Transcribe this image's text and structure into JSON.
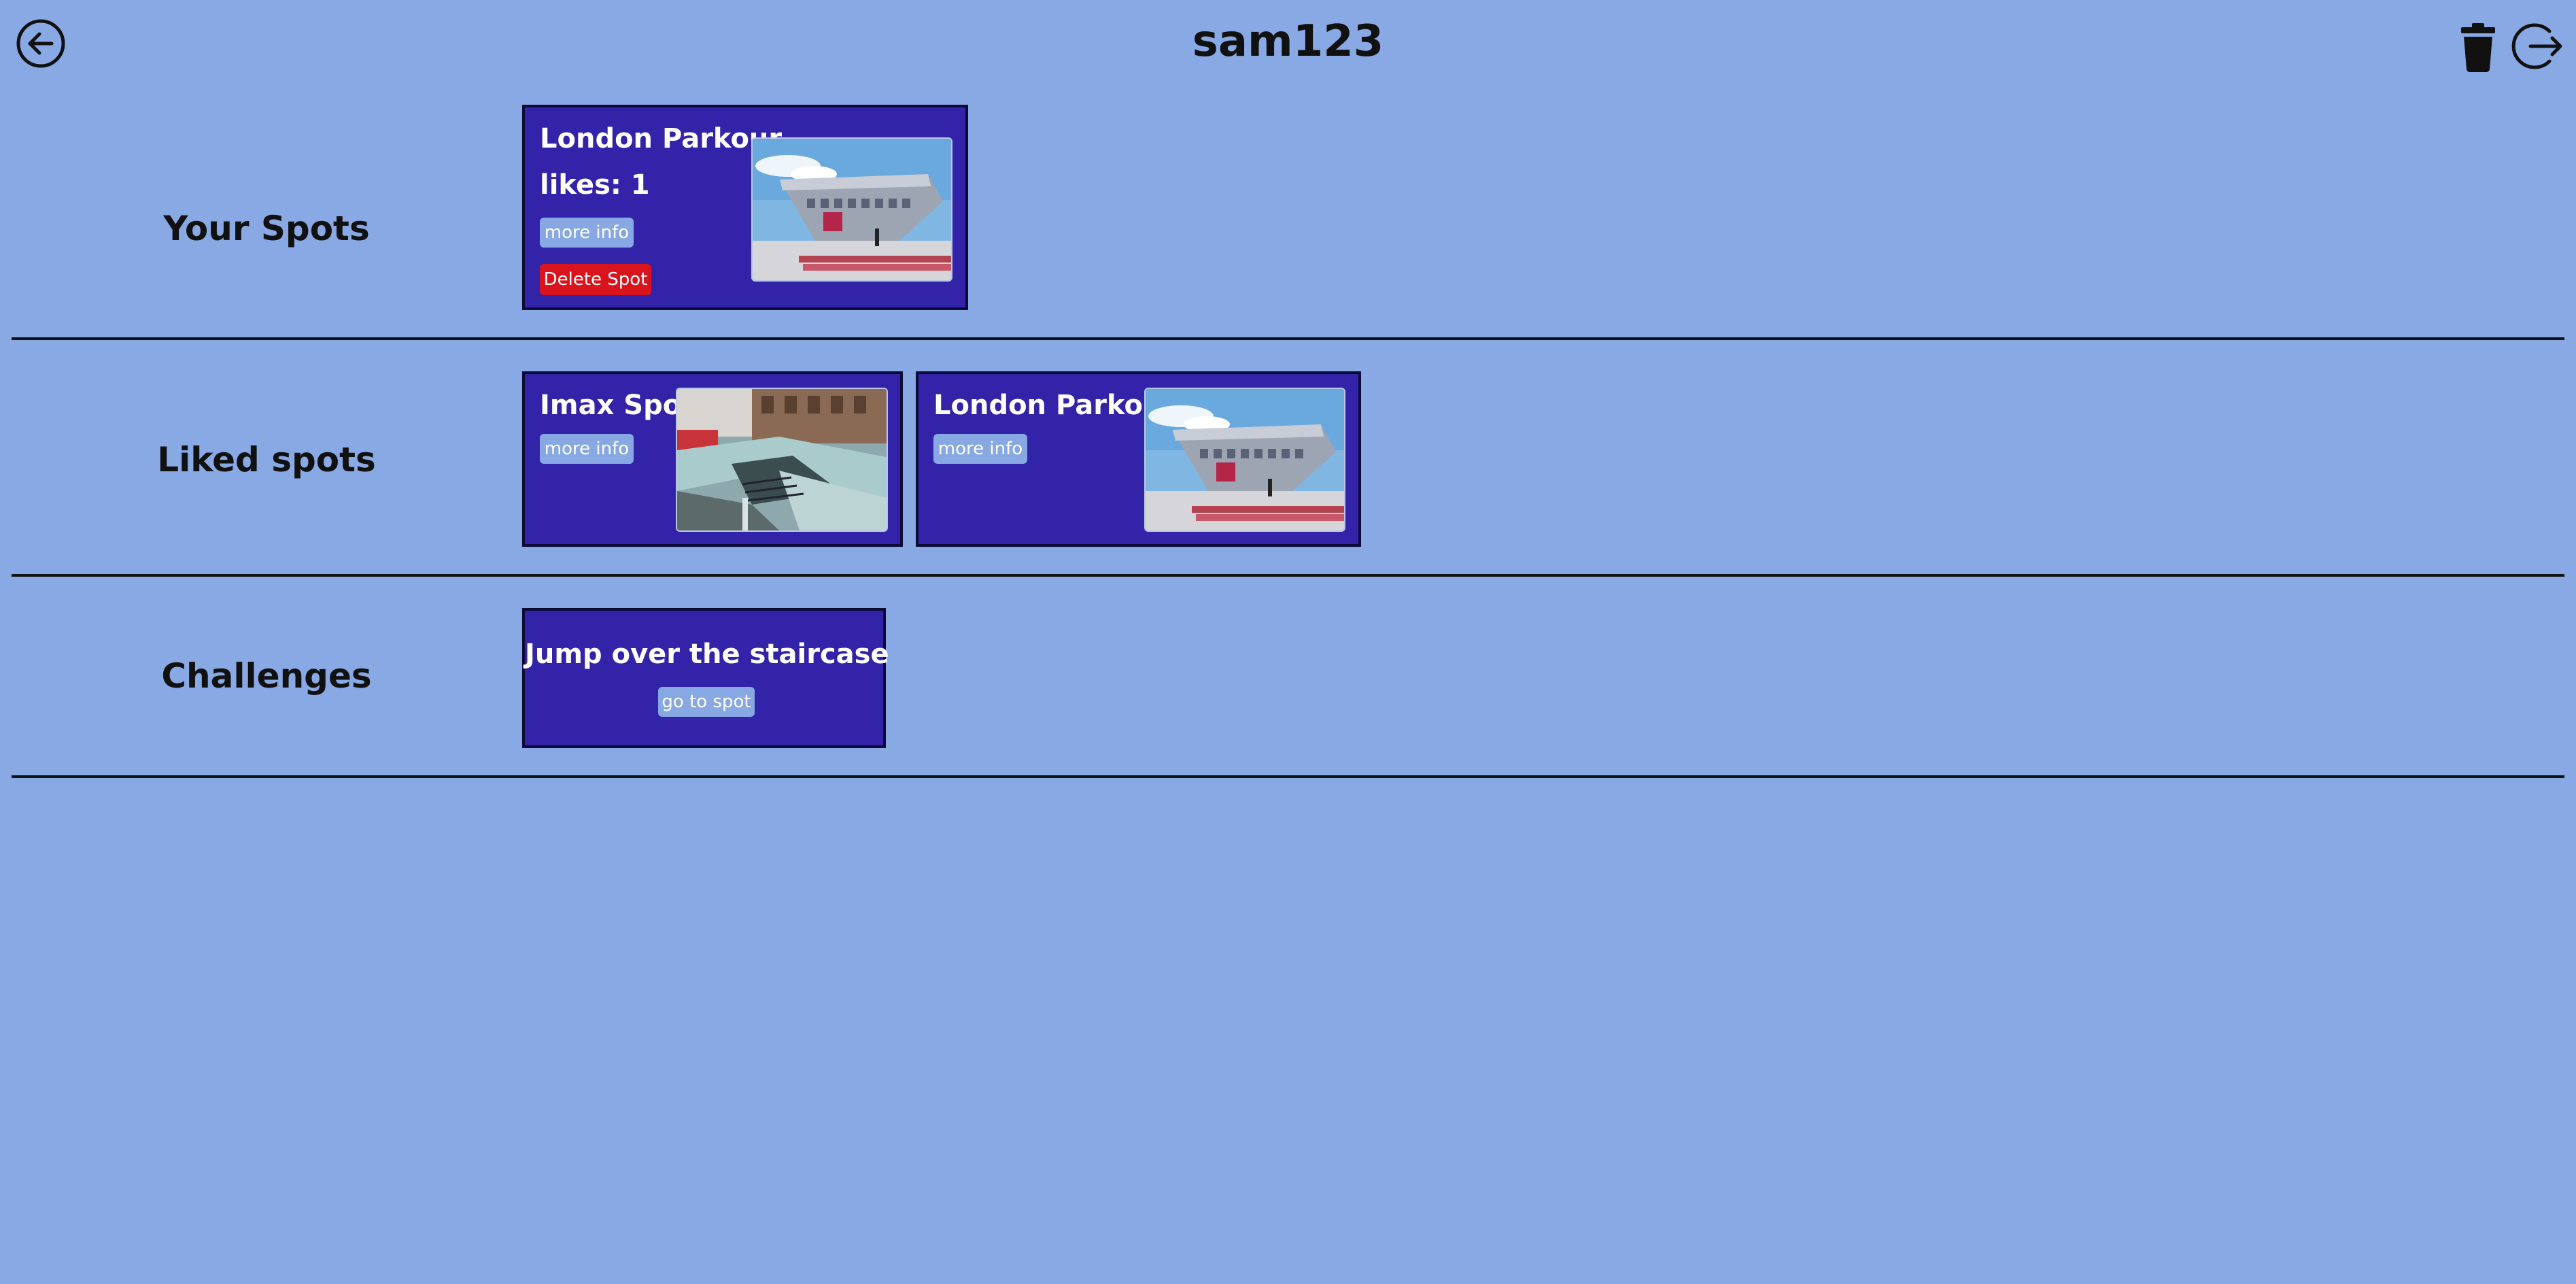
{
  "header": {
    "title": "sam123",
    "back_icon": "arrow-left-circle-icon",
    "trash_icon": "trash-icon",
    "logout_icon": "logout-icon"
  },
  "sections": {
    "your_spots": {
      "label": "Your Spots",
      "cards": [
        {
          "title": "London Parkour",
          "likes": "likes: 1",
          "more_info_label": "more info",
          "delete_label": "Delete Spot",
          "image_icon": "modern-building-photo"
        }
      ]
    },
    "liked_spots": {
      "label": "Liked spots",
      "cards": [
        {
          "title": "Imax Spot",
          "more_info_label": "more info",
          "image_icon": "underpass-stairs-photo"
        },
        {
          "title": "London Parkour",
          "more_info_label": "more info",
          "image_icon": "modern-building-photo"
        }
      ]
    },
    "challenges": {
      "label": "Challenges",
      "cards": [
        {
          "title": "Jump over the staircase",
          "go_label": "go to spot"
        }
      ]
    }
  },
  "colors": {
    "background": "#89a9e5",
    "card": "#3323a8",
    "button_info": "#88a8e3",
    "button_delete": "#d9141d"
  }
}
